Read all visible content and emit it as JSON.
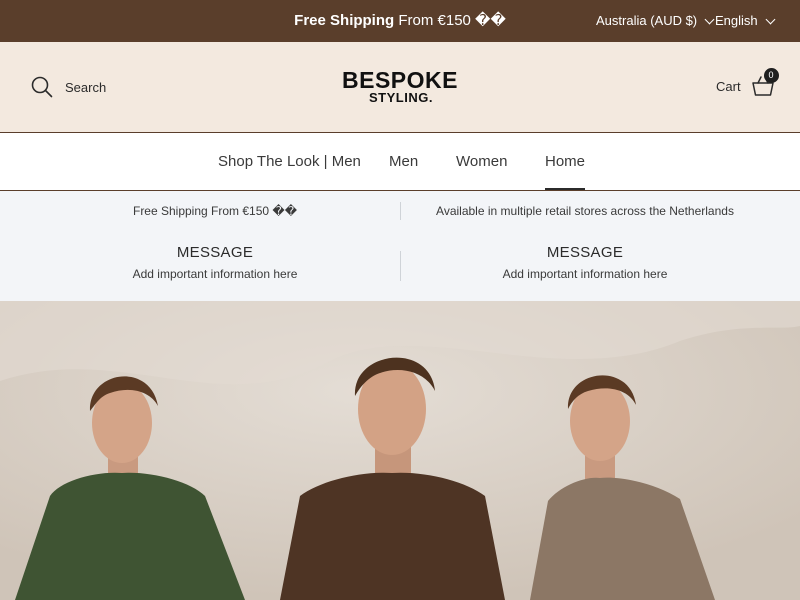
{
  "announcement": {
    "bold": "Free Shipping",
    "rest": "From €150 ��",
    "country": "Australia (AUD $)",
    "language": "English"
  },
  "header": {
    "search_label": "Search",
    "logo_line1": "BESPOKE",
    "logo_line2": "STYLING.",
    "cart_label": "Cart",
    "cart_count": "0"
  },
  "nav": {
    "items": [
      {
        "label": "Shop The Look | Men"
      },
      {
        "label": "Men"
      },
      {
        "label": "Women"
      },
      {
        "label": "Home",
        "active": true
      }
    ]
  },
  "info": {
    "top_left": "Free Shipping From €150 ��",
    "top_right": "Available in multiple retail stores across the Netherlands",
    "messages": [
      {
        "title": "MESSAGE",
        "text": "Add important information here"
      },
      {
        "title": "MESSAGE",
        "text": "Add important information here"
      }
    ]
  },
  "hero": {
    "shirt_colors": [
      "#3f5433",
      "#4e3424",
      "#8c7765"
    ]
  },
  "colors": {
    "announcement_bg": "#5a3e2b",
    "header_bg": "#f3e9df",
    "info_bg": "#f3f5f8"
  }
}
